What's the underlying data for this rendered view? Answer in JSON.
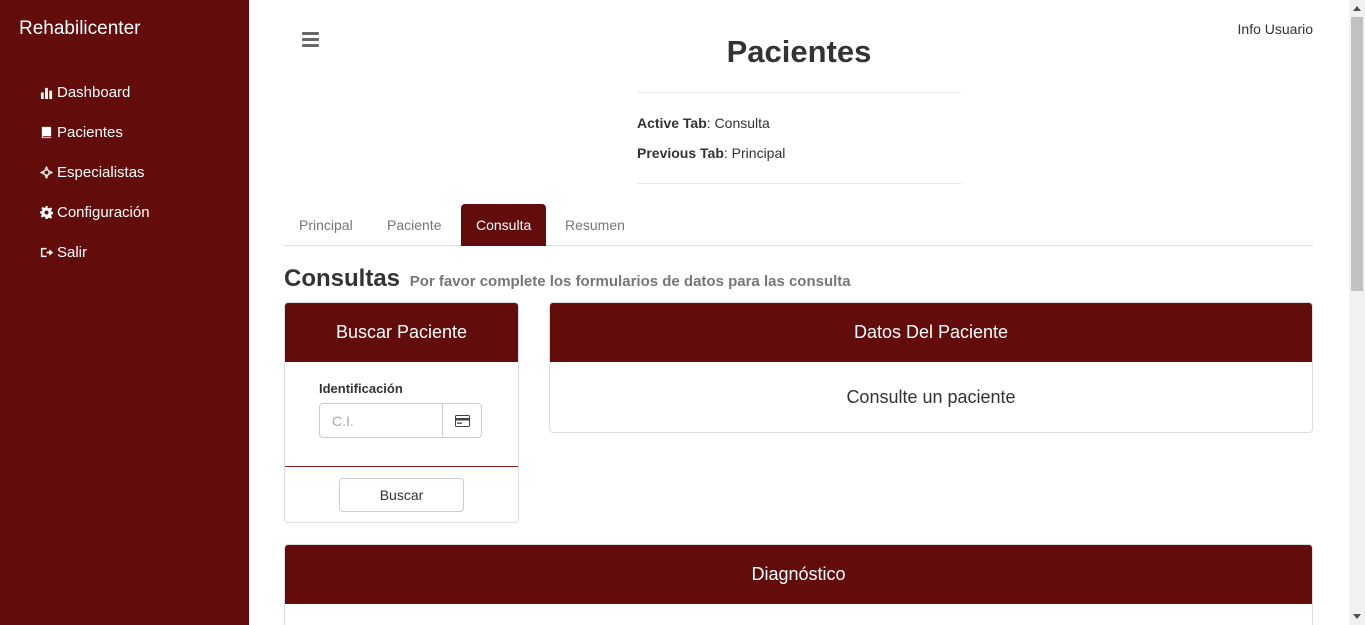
{
  "sidebar": {
    "brand": "Rehabilicenter",
    "items": [
      {
        "label": "Dashboard",
        "icon": "bar-chart-icon"
      },
      {
        "label": "Pacientes",
        "icon": "book-icon"
      },
      {
        "label": "Especialistas",
        "icon": "crosshair-icon"
      },
      {
        "label": "Configuración",
        "icon": "gear-icon"
      },
      {
        "label": "Salir",
        "icon": "logout-icon"
      }
    ]
  },
  "header": {
    "user_info": "Info Usuario",
    "title": "Pacientes",
    "active_tab_label": "Active Tab",
    "active_tab_value": ": Consulta",
    "previous_tab_label": "Previous Tab",
    "previous_tab_value": ": Principal"
  },
  "tabs": [
    {
      "label": "Principal",
      "active": false
    },
    {
      "label": "Paciente",
      "active": false
    },
    {
      "label": "Consulta",
      "active": true
    },
    {
      "label": "Resumen",
      "active": false
    }
  ],
  "section": {
    "title": "Consultas",
    "subtitle": "Por favor complete los formularios de datos para las consulta"
  },
  "buscar_panel": {
    "title": "Buscar Paciente",
    "field_label": "Identificación",
    "placeholder": "C.I.",
    "value": "",
    "button": "Buscar"
  },
  "datos_panel": {
    "title": "Datos Del Paciente",
    "message": "Consulte un paciente"
  },
  "diagnostico_panel": {
    "title": "Diagnóstico"
  },
  "colors": {
    "brand": "#630c0c",
    "sidebar_text": "#ffffff",
    "muted_text": "#777777"
  }
}
